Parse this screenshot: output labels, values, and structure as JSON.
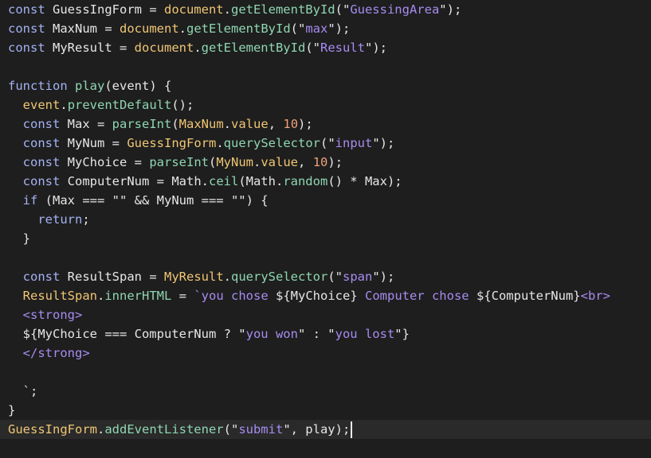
{
  "editor": {
    "language": "javascript",
    "current_line": 22,
    "colors": {
      "background": "#1e1e1e",
      "current_line_highlight": "#2a2a2a",
      "keyword": "#a4b2f3",
      "function": "#8fd6b3",
      "object": "#f0c674",
      "string": "#a68cf0",
      "number": "#f0a07a",
      "default": "#e6e6e6"
    },
    "lines": [
      [
        [
          "kw",
          "const"
        ],
        [
          "txt",
          " GuessIngForm = "
        ],
        [
          "obj",
          "document"
        ],
        [
          "txt",
          "."
        ],
        [
          "fn",
          "getElementById"
        ],
        [
          "txt",
          "(\""
        ],
        [
          "str",
          "GuessingArea"
        ],
        [
          "txt",
          "\");"
        ]
      ],
      [
        [
          "kw",
          "const"
        ],
        [
          "txt",
          " MaxNum = "
        ],
        [
          "obj",
          "document"
        ],
        [
          "txt",
          "."
        ],
        [
          "fn",
          "getElementById"
        ],
        [
          "txt",
          "(\""
        ],
        [
          "str",
          "max"
        ],
        [
          "txt",
          "\");"
        ]
      ],
      [
        [
          "kw",
          "const"
        ],
        [
          "txt",
          " MyResult = "
        ],
        [
          "obj",
          "document"
        ],
        [
          "txt",
          "."
        ],
        [
          "fn",
          "getElementById"
        ],
        [
          "txt",
          "(\""
        ],
        [
          "str",
          "Result"
        ],
        [
          "txt",
          "\");"
        ]
      ],
      [],
      [
        [
          "kw",
          "function"
        ],
        [
          "txt",
          " "
        ],
        [
          "fn",
          "play"
        ],
        [
          "txt",
          "(event) {"
        ]
      ],
      [
        [
          "txt",
          "  "
        ],
        [
          "obj",
          "event"
        ],
        [
          "txt",
          "."
        ],
        [
          "fn",
          "preventDefault"
        ],
        [
          "txt",
          "();"
        ]
      ],
      [
        [
          "txt",
          "  "
        ],
        [
          "kw",
          "const"
        ],
        [
          "txt",
          " Max = "
        ],
        [
          "fn",
          "parseInt"
        ],
        [
          "txt",
          "("
        ],
        [
          "obj",
          "MaxNum"
        ],
        [
          "txt",
          "."
        ],
        [
          "obj",
          "value"
        ],
        [
          "txt",
          ", "
        ],
        [
          "num",
          "10"
        ],
        [
          "txt",
          ");"
        ]
      ],
      [
        [
          "txt",
          "  "
        ],
        [
          "kw",
          "const"
        ],
        [
          "txt",
          " MyNum = "
        ],
        [
          "obj",
          "GuessIngForm"
        ],
        [
          "txt",
          "."
        ],
        [
          "fn",
          "querySelector"
        ],
        [
          "txt",
          "(\""
        ],
        [
          "str",
          "input"
        ],
        [
          "txt",
          "\");"
        ]
      ],
      [
        [
          "txt",
          "  "
        ],
        [
          "kw",
          "const"
        ],
        [
          "txt",
          " MyChoice = "
        ],
        [
          "fn",
          "parseInt"
        ],
        [
          "txt",
          "("
        ],
        [
          "obj",
          "MyNum"
        ],
        [
          "txt",
          "."
        ],
        [
          "obj",
          "value"
        ],
        [
          "txt",
          ", "
        ],
        [
          "num",
          "10"
        ],
        [
          "txt",
          ");"
        ]
      ],
      [
        [
          "txt",
          "  "
        ],
        [
          "kw",
          "const"
        ],
        [
          "txt",
          " ComputerNum = Math."
        ],
        [
          "fn",
          "ceil"
        ],
        [
          "txt",
          "(Math."
        ],
        [
          "fn",
          "random"
        ],
        [
          "txt",
          "() * Max);"
        ]
      ],
      [
        [
          "txt",
          "  "
        ],
        [
          "kw",
          "if"
        ],
        [
          "txt",
          " (Max === \"\" && MyNum === \"\") {"
        ]
      ],
      [
        [
          "txt",
          "    "
        ],
        [
          "kw",
          "return"
        ],
        [
          "txt",
          ";"
        ]
      ],
      [
        [
          "txt",
          "  }"
        ]
      ],
      [],
      [
        [
          "txt",
          "  "
        ],
        [
          "kw",
          "const"
        ],
        [
          "txt",
          " ResultSpan = "
        ],
        [
          "obj",
          "MyResult"
        ],
        [
          "txt",
          "."
        ],
        [
          "fn",
          "querySelector"
        ],
        [
          "txt",
          "(\""
        ],
        [
          "str",
          "span"
        ],
        [
          "txt",
          "\");"
        ]
      ],
      [
        [
          "txt",
          "  "
        ],
        [
          "obj",
          "ResultSpan"
        ],
        [
          "txt",
          "."
        ],
        [
          "fn",
          "innerHTML"
        ],
        [
          "txt",
          " = "
        ],
        [
          "str",
          "`you chose "
        ],
        [
          "txt",
          "${MyChoice}"
        ],
        [
          "str",
          " Computer chose "
        ],
        [
          "txt",
          "${ComputerNum}"
        ],
        [
          "str",
          "<br>"
        ]
      ],
      [
        [
          "txt",
          "  "
        ],
        [
          "str",
          "<strong>"
        ]
      ],
      [
        [
          "txt",
          "  ${MyChoice === ComputerNum ? \""
        ],
        [
          "str",
          "you won"
        ],
        [
          "txt",
          "\" : \""
        ],
        [
          "str",
          "you lost"
        ],
        [
          "txt",
          "\"}"
        ]
      ],
      [
        [
          "txt",
          "  "
        ],
        [
          "str",
          "</strong>"
        ]
      ],
      [],
      [
        [
          "txt",
          "  `;"
        ]
      ],
      [
        [
          "txt",
          "}"
        ]
      ],
      [
        [
          "obj",
          "GuessIngForm"
        ],
        [
          "txt",
          "."
        ],
        [
          "fn",
          "addEventListener"
        ],
        [
          "txt",
          "(\""
        ],
        [
          "str",
          "submit"
        ],
        [
          "txt",
          "\", play);"
        ]
      ]
    ]
  }
}
